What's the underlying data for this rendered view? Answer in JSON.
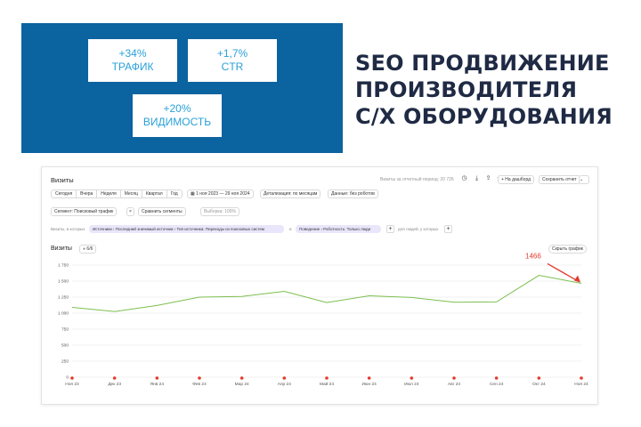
{
  "hero": {
    "stats": [
      {
        "value": "+34%",
        "label": "ТРАФИК"
      },
      {
        "value": "+1,7%",
        "label": "CTR"
      },
      {
        "value": "+20%",
        "label": "ВИДИМОСТЬ"
      }
    ],
    "title_lines": [
      "SEO ПРОДВИЖЕНИЕ",
      "ПРОИЗВОДИТЕЛЯ",
      "С/Х ОБОРУДОВАНИЯ"
    ]
  },
  "report": {
    "title": "Визиты",
    "period_note": "Визиты за отчетный период: 20 726",
    "toolbar": {
      "dashboard_button": "+ На дашборд",
      "save_button": "Сохранить отчет"
    },
    "period_tabs": [
      "Сегодня",
      "Вчера",
      "Неделя",
      "Месяц",
      "Квартал",
      "Год"
    ],
    "date_range": "1 ноя 2023 — 29 ноя 2024",
    "detail": "Детализация: по месяцам",
    "data_filter": "Данные: без роботов",
    "segment": "Сегмент: Поисковый трафик",
    "compare": "Сравнить сегменты",
    "sample": "Выборка: 100%",
    "filter_prefix": "Визиты, в которых",
    "filter_chip_1": "Источники › Последний значимый источник › Тип источника: Переходы из поисковых систем",
    "filter_and": "и",
    "filter_chip_2": "Поведение › Роботность: Только люди",
    "filter_people": "для людей, у которых",
    "metric_label": "Визиты",
    "metric_select": "6/6",
    "hide_chart": "Скрыть график",
    "annotation": "1466"
  },
  "chart_data": {
    "type": "line",
    "title": "",
    "xlabel": "",
    "ylabel": "Визиты",
    "categories": [
      "Ноя 23",
      "Дек 23",
      "Янв 24",
      "Фев 24",
      "Мар 24",
      "Апр 24",
      "Май 24",
      "Июн 24",
      "Июл 24",
      "Авг 24",
      "Сен 24",
      "Окт 24",
      "Ноя 24"
    ],
    "values": [
      1090,
      1025,
      1120,
      1250,
      1260,
      1340,
      1165,
      1270,
      1245,
      1170,
      1175,
      1590,
      1466
    ],
    "yticks": [
      "0",
      "250",
      "500",
      "750",
      "1 000",
      "1 250",
      "1 500",
      "1 750"
    ],
    "ylim": [
      0,
      1750
    ],
    "series_color": "#7bbf4e",
    "grid": true,
    "annotations": [
      {
        "label": "1466",
        "category": "Ноя 24",
        "color": "#e23b2e"
      }
    ]
  }
}
